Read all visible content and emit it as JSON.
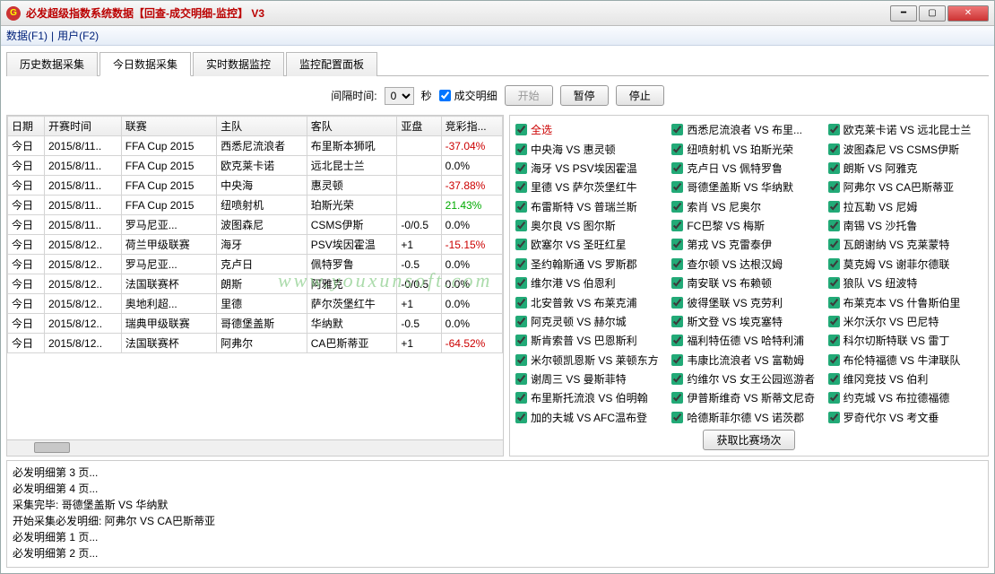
{
  "window": {
    "title": "必发超级指数系统数据【回查-成交明细-监控】 V3"
  },
  "menu": {
    "data": "数据(F1)",
    "sep": "|",
    "user": "用户(F2)"
  },
  "tabs": [
    "历史数据采集",
    "今日数据采集",
    "实时数据监控",
    "监控配置面板"
  ],
  "activeTab": 1,
  "toolbar": {
    "intervalLabel": "间隔时间:",
    "intervalValue": "0",
    "intervalUnit": "秒",
    "detailLabel": "成交明细",
    "start": "开始",
    "pause": "暂停",
    "stop": "停止"
  },
  "columns": [
    "日期",
    "开赛时间",
    "联赛",
    "主队",
    "客队",
    "亚盘",
    "竞彩指..."
  ],
  "rows": [
    {
      "c": [
        "今日",
        "2015/8/11..",
        "FFA Cup 2015",
        "西悉尼流浪者",
        "布里斯本狮吼",
        "",
        "-37.04%"
      ],
      "cls": "red"
    },
    {
      "c": [
        "今日",
        "2015/8/11..",
        "FFA Cup 2015",
        "欧克莱卡诺",
        "远北昆士兰",
        "",
        "0.0%"
      ],
      "cls": ""
    },
    {
      "c": [
        "今日",
        "2015/8/11..",
        "FFA Cup 2015",
        "中央海",
        "惠灵顿",
        "",
        "-37.88%"
      ],
      "cls": "red"
    },
    {
      "c": [
        "今日",
        "2015/8/11..",
        "FFA Cup 2015",
        "纽喷射机",
        "珀斯光荣",
        "",
        "21.43%"
      ],
      "cls": "green"
    },
    {
      "c": [
        "今日",
        "2015/8/11..",
        "罗马尼亚...",
        "波图森尼",
        "CSMS伊斯",
        "-0/0.5",
        "0.0%"
      ],
      "cls": ""
    },
    {
      "c": [
        "今日",
        "2015/8/12..",
        "荷兰甲级联赛",
        "海牙",
        "PSV埃因霍温",
        "+1",
        "-15.15%"
      ],
      "cls": "red"
    },
    {
      "c": [
        "今日",
        "2015/8/12..",
        "罗马尼亚...",
        "克卢日",
        "佩特罗鲁",
        "-0.5",
        "0.0%"
      ],
      "cls": ""
    },
    {
      "c": [
        "今日",
        "2015/8/12..",
        "法国联赛杯",
        "朗斯",
        "阿雅克",
        "-0/0.5",
        "0.0%"
      ],
      "cls": ""
    },
    {
      "c": [
        "今日",
        "2015/8/12..",
        "奥地利超...",
        "里德",
        "萨尔茨堡红牛",
        "+1",
        "0.0%"
      ],
      "cls": ""
    },
    {
      "c": [
        "今日",
        "2015/8/12..",
        "瑞典甲级联赛",
        "哥德堡盖斯",
        "华纳默",
        "-0.5",
        "0.0%"
      ],
      "cls": ""
    },
    {
      "c": [
        "今日",
        "2015/8/12..",
        "法国联赛杯",
        "阿弗尔",
        "CA巴斯蒂亚",
        "+1",
        "-64.52%"
      ],
      "cls": "red"
    }
  ],
  "selectAll": "全选",
  "checks": [
    [
      "中央海 VS 惠灵顿",
      "海牙 VS PSV埃因霍温",
      "里德 VS 萨尔茨堡红牛",
      "布雷斯特 VS 普瑞兰斯",
      "奥尔良 VS 图尔斯",
      "欧塞尔 VS 圣旺红星",
      "圣约翰斯通 VS 罗斯郡",
      "维尔港 VS 伯恩利",
      "北安普敦 VS 布莱克浦",
      "阿克灵顿 VS 赫尔城",
      "斯肯索普 VS 巴恩斯利",
      "米尔顿凯恩斯 VS 莱顿东方",
      "谢周三 VS 曼斯菲特",
      "布里斯托流浪 VS 伯明翰",
      "加的夫城 VS AFC温布登"
    ],
    [
      "西悉尼流浪者 VS 布里...",
      "纽喷射机 VS 珀斯光荣",
      "克卢日 VS 佩特罗鲁",
      "哥德堡盖斯 VS 华纳默",
      "索肖 VS 尼奥尔",
      "FC巴黎 VS 梅斯",
      "第戎 VS 克雷泰伊",
      "查尔顿 VS 达根汉姆",
      "南安联 VS 布赖顿",
      "彼得堡联 VS 克劳利",
      "斯文登 VS 埃克塞特",
      "福利特伍德 VS 哈特利浦",
      "韦康比流浪者 VS 富勒姆",
      "约维尔 VS 女王公园巡游者",
      "伊普斯维奇 VS 斯蒂文尼奇",
      "哈德斯菲尔德 VS 诺茨郡"
    ],
    [
      "欧克莱卡诺 VS 远北昆士兰",
      "波图森尼 VS CSMS伊斯",
      "朗斯 VS 阿雅克",
      "阿弗尔 VS CA巴斯蒂亚",
      "拉瓦勒 VS 尼姆",
      "南锡 VS 沙托鲁",
      "瓦朗谢纳 VS 克莱蒙特",
      "莫克姆 VS 谢菲尔德联",
      "狼队 VS 纽波特",
      "布莱克本 VS 什鲁斯伯里",
      "米尔沃尔 VS 巴尼特",
      "科尔切斯特联 VS 雷丁",
      "布伦特福德 VS 牛津联队",
      "维冈竞技 VS 伯利",
      "约克城 VS 布拉德福德",
      "罗奇代尔 VS 考文垂"
    ]
  ],
  "fetchBtn": "获取比赛场次",
  "log": [
    "必发明细第 3 页...",
    "必发明细第 4 页...",
    "采集完毕: 哥德堡盖斯 VS 华纳默",
    "开始采集必发明细: 阿弗尔 VS CA巴斯蒂亚",
    "必发明细第 1 页...",
    "必发明细第 2 页..."
  ],
  "watermark": "www.youxunsoft.com"
}
